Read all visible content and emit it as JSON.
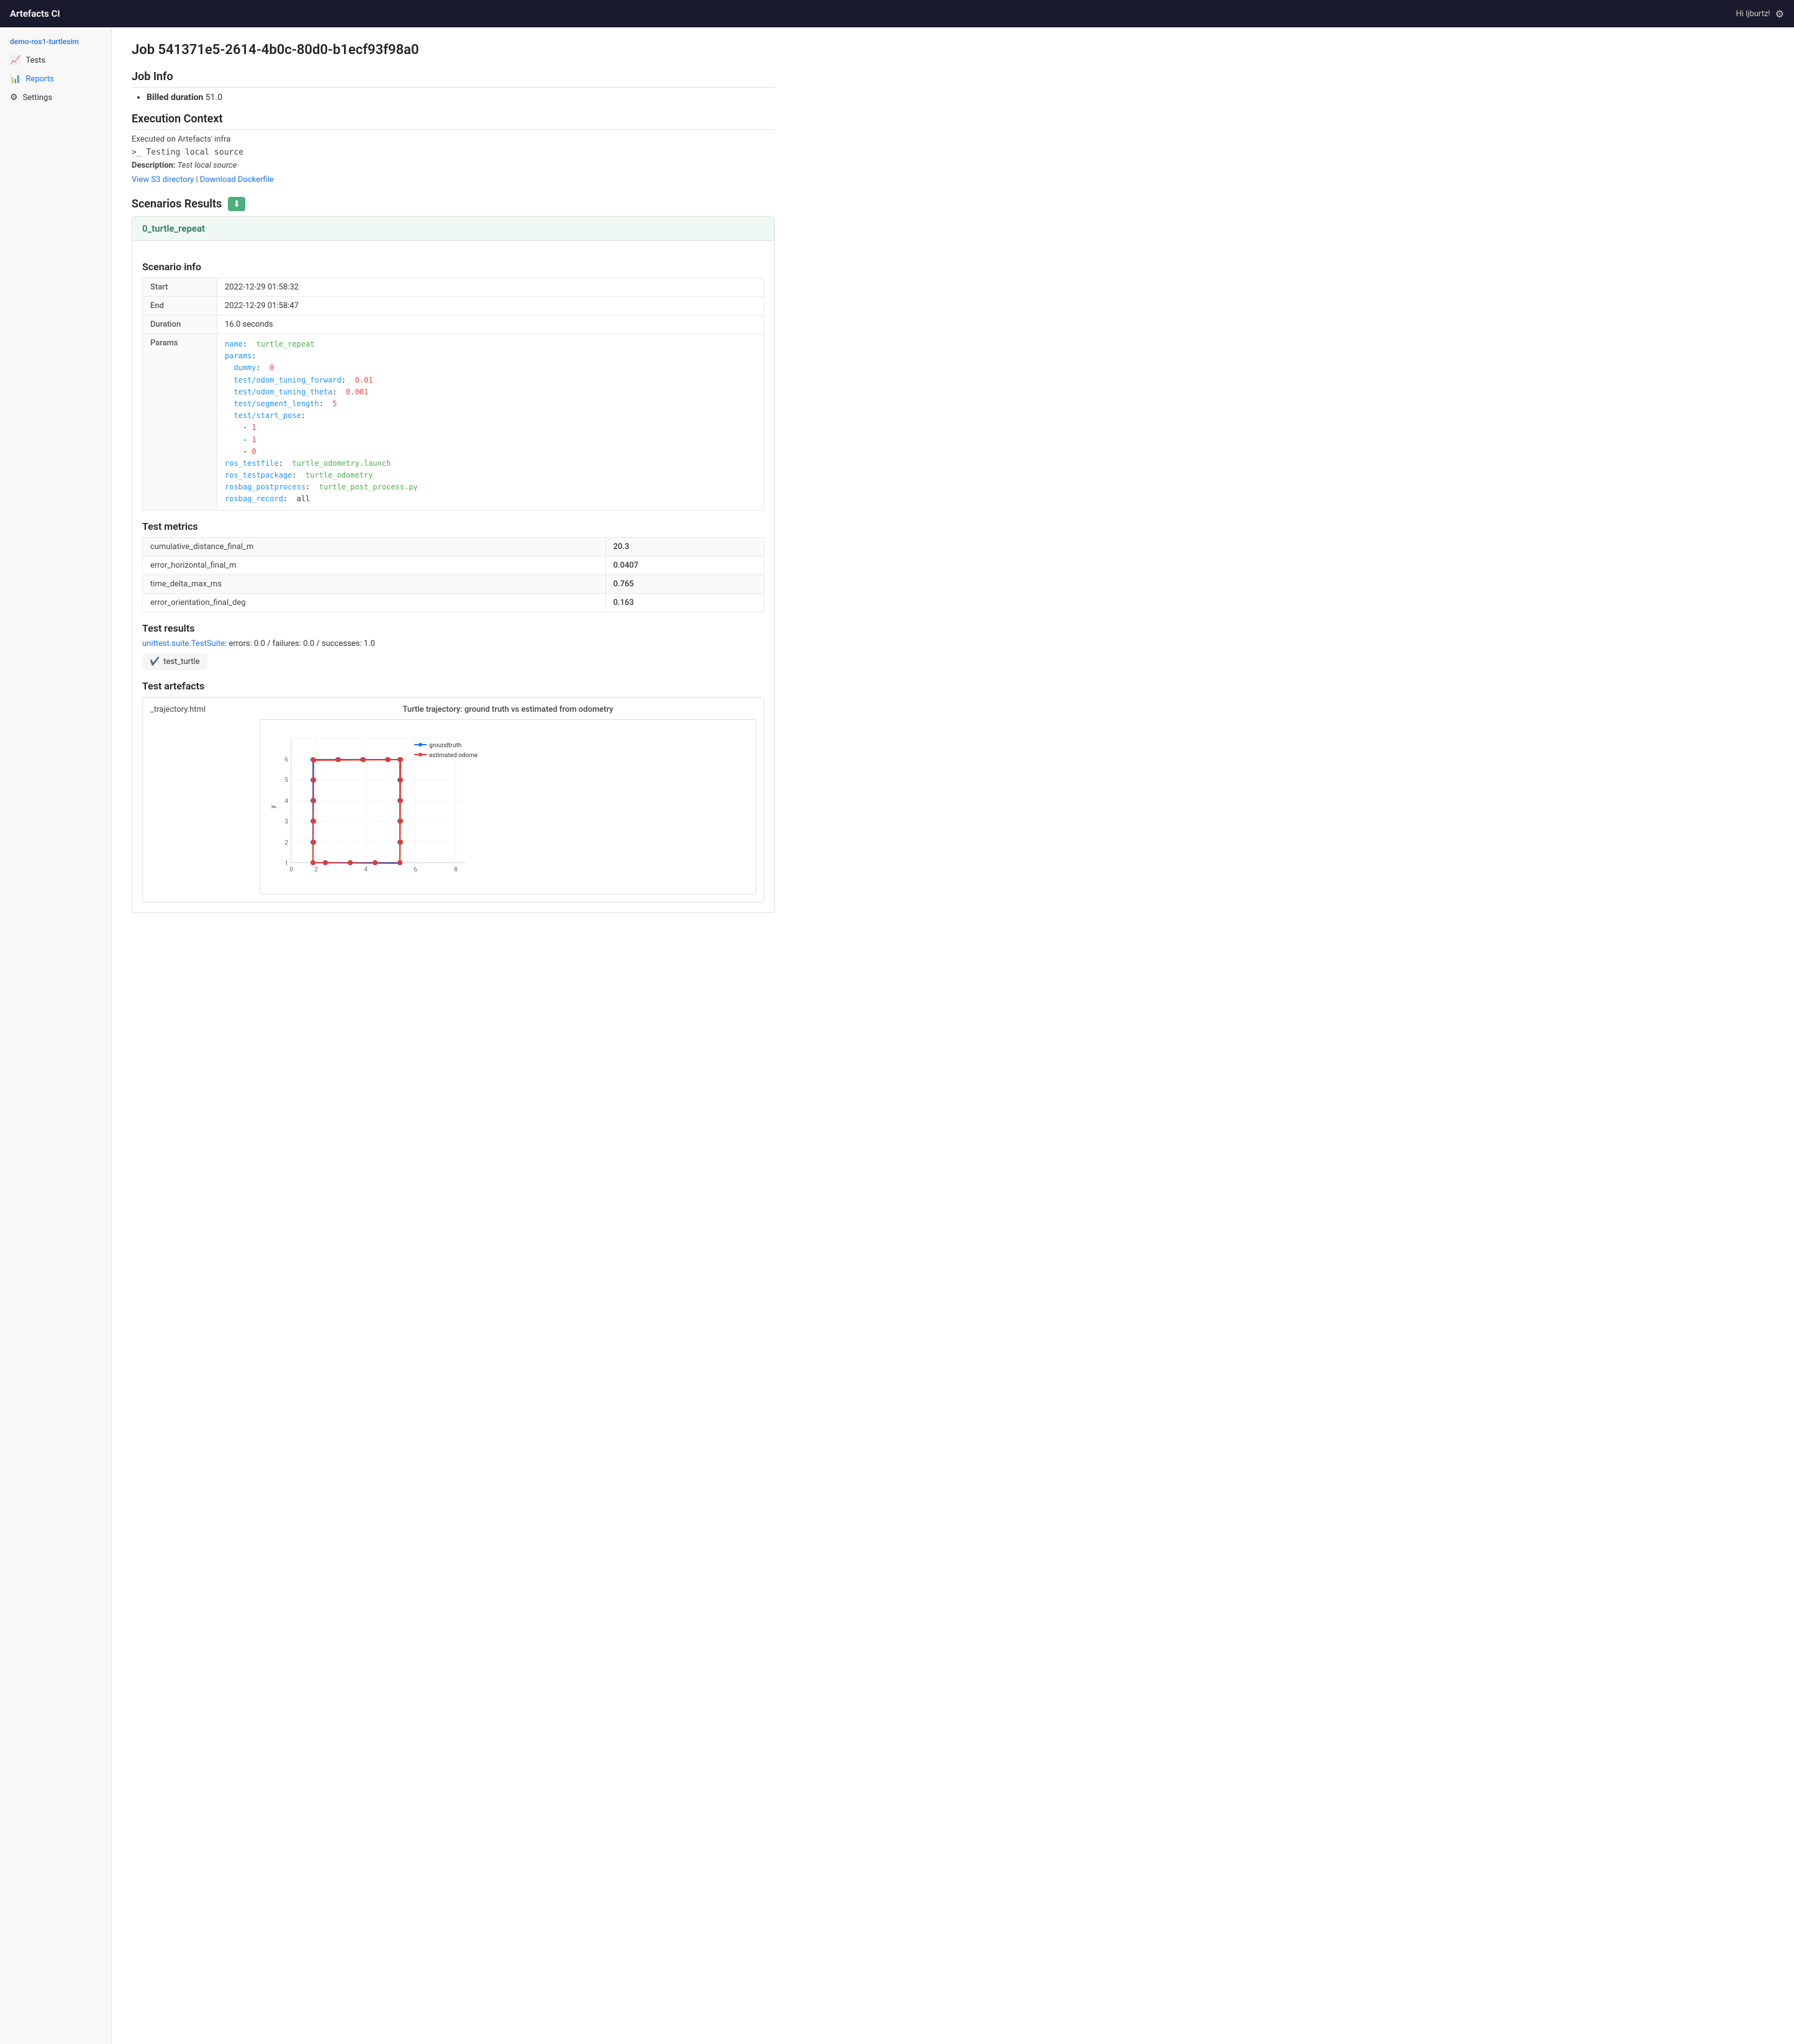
{
  "navbar": {
    "brand": "Artefacts CI",
    "user_greeting": "Hi ljburtz!",
    "gear_icon": "⚙"
  },
  "sidebar": {
    "project": "demo-ros1-turtlesim",
    "items": [
      {
        "label": "Tests",
        "icon": "📈",
        "active": false
      },
      {
        "label": "Reports",
        "icon": "📊",
        "active": true
      },
      {
        "label": "Settings",
        "icon": "⚙",
        "active": false
      }
    ]
  },
  "page": {
    "job_id": "Job 541371e5-2614-4b0c-80d0-b1ecf93f98a0",
    "job_info_heading": "Job Info",
    "billed_duration_label": "Billed duration",
    "billed_duration_value": "51.0",
    "execution_heading": "Execution Context",
    "executed_on": "Executed on Artefacts' infra",
    "terminal_line": ">_ Testing local source",
    "description_label": "Description:",
    "description_value": "Test local source",
    "view_s3_link": "View S3 directory",
    "download_dockerfile_link": "Download Dockerfile",
    "scenarios_heading": "Scenarios Results",
    "download_btn_icon": "⬇",
    "scenario_name": "0_turtle_repeat",
    "scenario_info_heading": "Scenario info",
    "scenario_table": [
      {
        "label": "Start",
        "value": "2022-12-29 01:58:32"
      },
      {
        "label": "End",
        "value": "2022-12-29 01:58:47"
      },
      {
        "label": "Duration",
        "value": "16.0 seconds"
      }
    ],
    "params_label": "Params",
    "params_content": "name:  turtle_repeat\nparams:\n  dummy:  0\n  test/odom_tuning_forward:  0.01\n  test/odom_tuning_theta:  0.001\n  test/segment_length:  5\n  test/start_pose:\n    - 1\n    - 1\n    - 0\nros_testfile:  turtle_odometry.launch\nros_testpackage:  turtle_odometry\nrosbag_postprocess:  turtle_post_process.py\nrosbag_record:  all",
    "test_metrics_heading": "Test metrics",
    "metrics": [
      {
        "key": "cumulative_distance_final_m",
        "value": "20.3"
      },
      {
        "key": "error_horizontal_final_m",
        "value": "0.0407"
      },
      {
        "key": "time_delta_max_ms",
        "value": "0.765"
      },
      {
        "key": "error_orientation_final_deg",
        "value": "0.163"
      }
    ],
    "test_results_heading": "Test results",
    "test_suite_prefix": "unittest.suite.TestSuite",
    "test_suite_stats": ": errors: 0.0 / failures: 0.0 / successes: 1.0",
    "test_item_icon": "✔️",
    "test_item_name": "test_turtle",
    "test_artefacts_heading": "Test artefacts",
    "artefact_filename": "_trajectory.html",
    "chart_title": "Turtle trajectory: ground truth vs estimated from odometry",
    "legend": [
      {
        "label": "groundtruth",
        "color": "#1a73e8"
      },
      {
        "label": "estimated odometry",
        "color": "#e53935"
      }
    ]
  }
}
